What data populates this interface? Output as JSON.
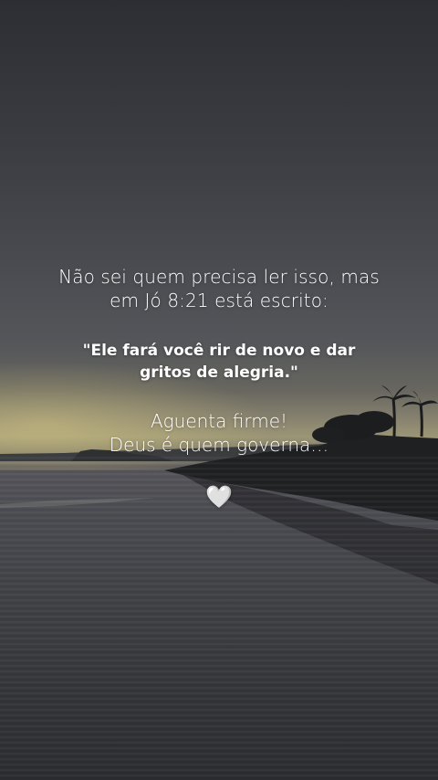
{
  "message": {
    "intro_line1": "Não sei quem precisa ler isso, mas",
    "intro_line2": "em Jó 8:21 está escrito:",
    "quote_line1": "\"Ele fará você rir de novo e dar",
    "quote_line2": "gritos de alegria.\"",
    "encourage_line1": "Aguenta firme!",
    "encourage_line2": "Deus é quem governa…",
    "heart": "🤍"
  },
  "icons": {
    "heart": "white-heart-icon"
  },
  "colors": {
    "text": "#ffffff",
    "sky_top": "#2c2e33",
    "horizon_glow": "#9c9676",
    "water": "#3e3f43"
  }
}
